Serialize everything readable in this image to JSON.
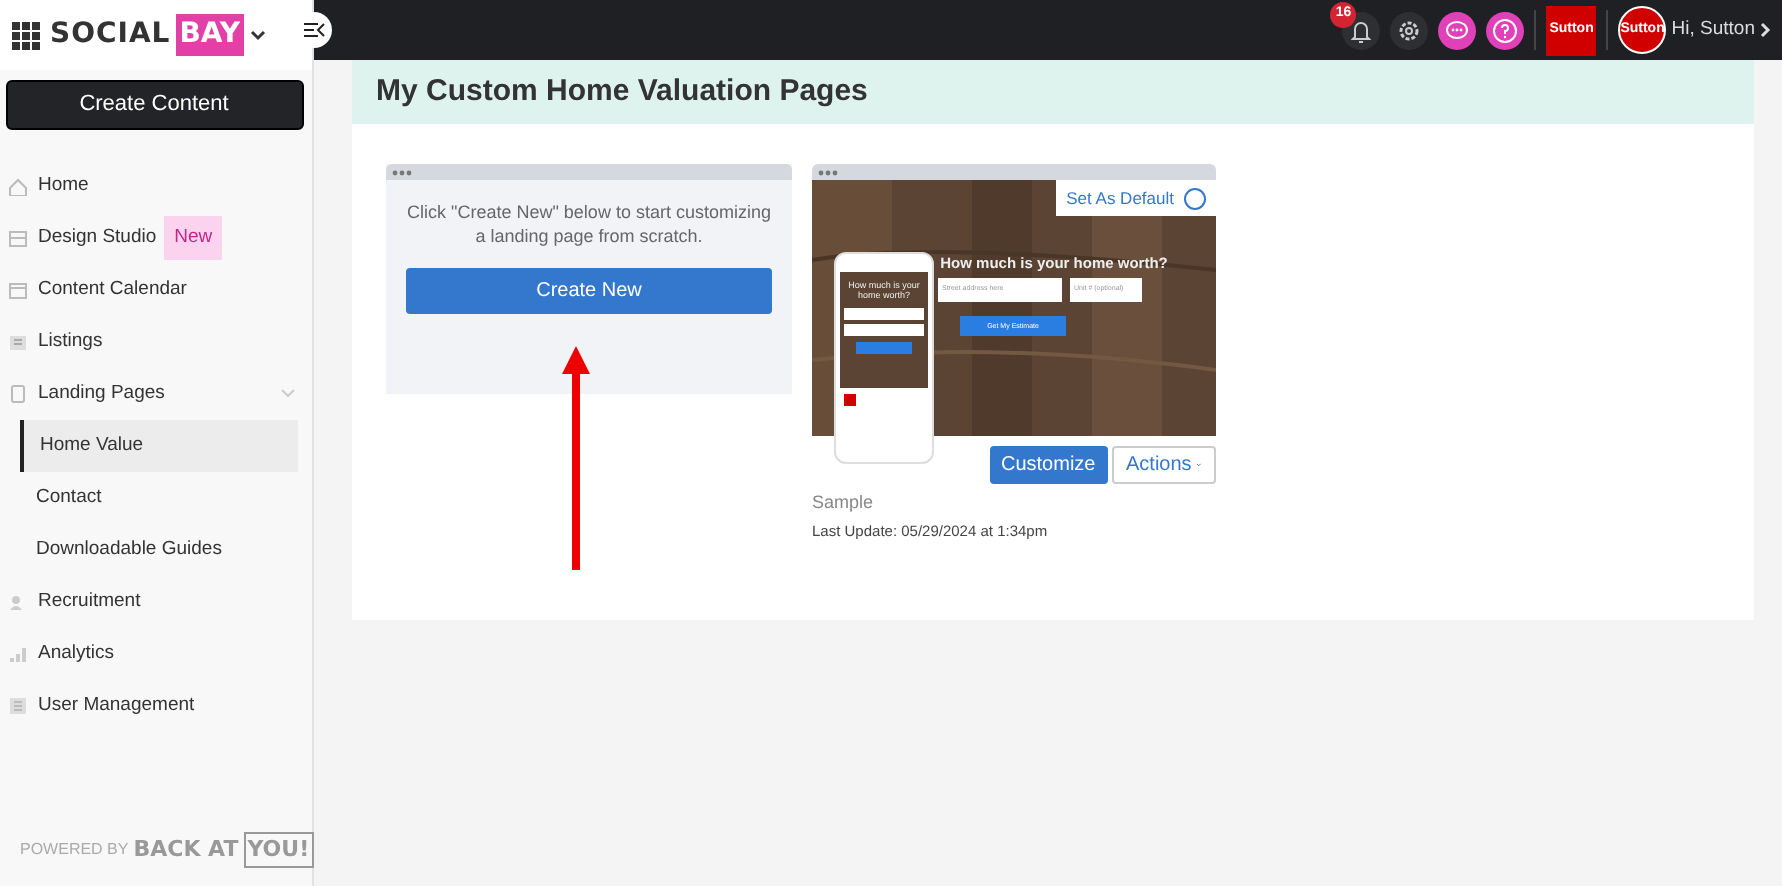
{
  "brand": {
    "word_1": "SOCIAL",
    "word_2": "BAY"
  },
  "sidebar": {
    "create_button": "Create Content",
    "items": [
      {
        "label": "Home",
        "selected": false
      },
      {
        "label": "Design Studio",
        "badge": "New",
        "selected": false
      },
      {
        "label": "Content Calendar",
        "selected": false
      },
      {
        "label": "Listings",
        "selected": false
      },
      {
        "label": "Landing Pages",
        "expanded": true,
        "selected": false,
        "children": [
          {
            "label": "Home Value",
            "selected": true
          },
          {
            "label": "Contact",
            "selected": false
          },
          {
            "label": "Downloadable Guides",
            "selected": false
          }
        ]
      },
      {
        "label": "Recruitment",
        "selected": false
      },
      {
        "label": "Analytics",
        "selected": false
      },
      {
        "label": "User Management",
        "selected": false
      }
    ],
    "footer": {
      "prefix": "POWERED BY",
      "brand_1": "BACK AT",
      "brand_2": "YOU!"
    }
  },
  "topbar": {
    "notification_count": "16",
    "logo": "Sutton",
    "avatar": "Sutton",
    "greeting": "Hi, Sutton"
  },
  "page": {
    "title": "My Custom Home Valuation Pages",
    "blank_card": {
      "text": "Click \"Create New\" below to start customizing a landing page from scratch.",
      "button": "Create New"
    },
    "templates": [
      {
        "preview": {
          "heading": "How much is your home worth?",
          "address_placeholder": "Street address here",
          "unit_placeholder": "Unit # (optional)",
          "button": "Get My Estimate",
          "phone_heading": "How much is your home worth?"
        },
        "default_label": "Set As Default",
        "is_default": false,
        "customize": "Customize",
        "actions": "Actions",
        "name": "Sample",
        "updated": "Last Update: 05/29/2024 at 1:34pm"
      }
    ]
  }
}
